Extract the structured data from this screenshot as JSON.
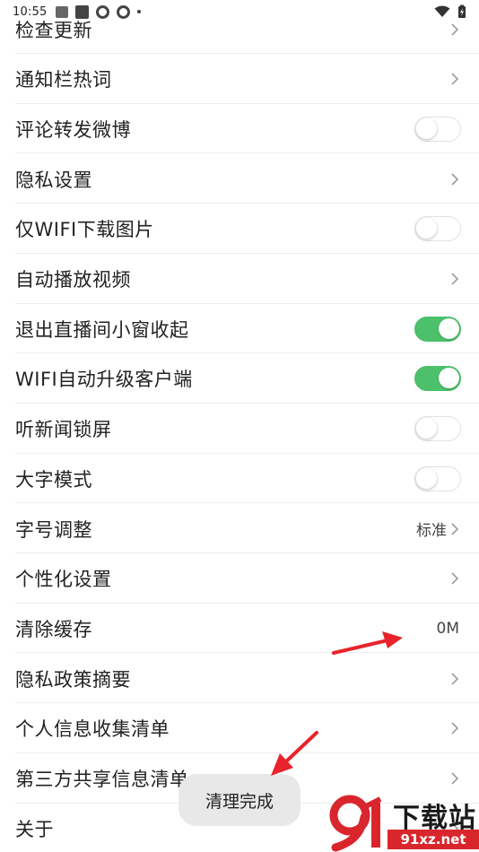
{
  "status_bar": {
    "time": "10:55",
    "icons_left": [
      "gallery-icon",
      "square-icon",
      "aperture-icon",
      "aperture-icon",
      "dot-icon"
    ],
    "icons_right": [
      "wifi-icon",
      "battery-charging-icon"
    ]
  },
  "settings": {
    "items": [
      {
        "label": "检查更新",
        "control": "chevron"
      },
      {
        "label": "通知栏热词",
        "control": "chevron"
      },
      {
        "label": "评论转发微博",
        "control": "toggle",
        "on": false
      },
      {
        "label": "隐私设置",
        "control": "chevron"
      },
      {
        "label": "仅WIFI下载图片",
        "control": "toggle",
        "on": false
      },
      {
        "label": "自动播放视频",
        "control": "chevron"
      },
      {
        "label": "退出直播间小窗收起",
        "control": "toggle",
        "on": true
      },
      {
        "label": "WIFI自动升级客户端",
        "control": "toggle",
        "on": true
      },
      {
        "label": "听新闻锁屏",
        "control": "toggle",
        "on": false
      },
      {
        "label": "大字模式",
        "control": "toggle",
        "on": false
      },
      {
        "label": "字号调整",
        "control": "chevron",
        "value": "标准"
      },
      {
        "label": "个性化设置",
        "control": "chevron"
      },
      {
        "label": "清除缓存",
        "control": "value",
        "value": "0M"
      },
      {
        "label": "隐私政策摘要",
        "control": "chevron"
      },
      {
        "label": "个人信息收集清单",
        "control": "chevron"
      },
      {
        "label": "第三方共享信息清单",
        "control": "chevron"
      },
      {
        "label": "关于",
        "control": "chevron"
      }
    ]
  },
  "toast": {
    "text": "清理完成"
  },
  "colors": {
    "toggle_on": "#4cc06a",
    "arrow": "#e8232b",
    "toast_bg": "#e8e8e8"
  },
  "watermark": {
    "title": "下载站",
    "url": "91xz.net"
  }
}
